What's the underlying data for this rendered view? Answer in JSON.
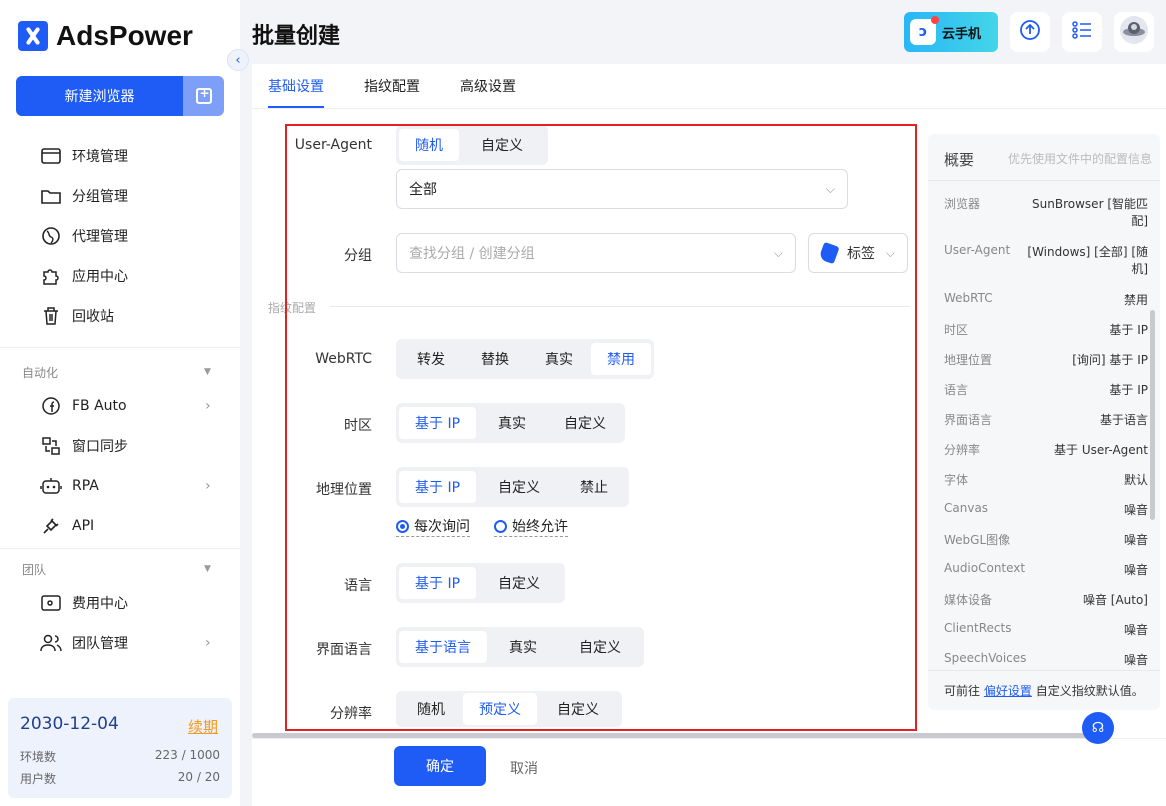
{
  "app": {
    "brand": "AdsPower"
  },
  "sidebar": {
    "new_browser": "新建浏览器",
    "items": [
      {
        "label": "环境管理",
        "icon": "browser-window-icon"
      },
      {
        "label": "分组管理",
        "icon": "folder-icon"
      },
      {
        "label": "代理管理",
        "icon": "proxy-globe-icon"
      },
      {
        "label": "应用中心",
        "icon": "puzzle-icon"
      },
      {
        "label": "回收站",
        "icon": "trash-icon"
      }
    ],
    "automation_title": "自动化",
    "automation_items": [
      {
        "label": "FB Auto",
        "icon": "facebook-icon"
      },
      {
        "label": "窗口同步",
        "icon": "window-sync-icon"
      },
      {
        "label": "RPA",
        "icon": "robot-icon"
      },
      {
        "label": "API",
        "icon": "plug-icon"
      }
    ],
    "team_title": "团队",
    "team_items": [
      {
        "label": "费用中心",
        "icon": "wallet-icon"
      },
      {
        "label": "团队管理",
        "icon": "team-icon"
      }
    ],
    "subscription": {
      "date": "2030-12-04",
      "renew": "续期",
      "env_label": "环境数",
      "env_value": "223 / 1000",
      "user_label": "用户数",
      "user_value": "20 / 20"
    }
  },
  "header": {
    "title": "批量创建",
    "cloud_phone": "云手机"
  },
  "tabs": [
    "基础设置",
    "指纹配置",
    "高级设置"
  ],
  "form": {
    "user_agent": {
      "label": "User-Agent",
      "options": [
        "随机",
        "自定义"
      ],
      "selected": "随机",
      "select_value": "全部"
    },
    "group": {
      "label": "分组",
      "placeholder": "查找分组 / 创建分组",
      "tag_label": "标签"
    },
    "section_title": "指纹配置",
    "webrtc": {
      "label": "WebRTC",
      "options": [
        "转发",
        "替换",
        "真实",
        "禁用"
      ],
      "selected": "禁用"
    },
    "timezone": {
      "label": "时区",
      "options": [
        "基于 IP",
        "真实",
        "自定义"
      ],
      "selected": "基于 IP"
    },
    "geo": {
      "label": "地理位置",
      "options": [
        "基于 IP",
        "自定义",
        "禁止"
      ],
      "selected": "基于 IP",
      "radios": [
        "每次询问",
        "始终允许"
      ],
      "radio_selected": "每次询问"
    },
    "language": {
      "label": "语言",
      "options": [
        "基于 IP",
        "自定义"
      ],
      "selected": "基于 IP"
    },
    "ui_language": {
      "label": "界面语言",
      "options": [
        "基于语言",
        "真实",
        "自定义"
      ],
      "selected": "基于语言"
    },
    "resolution": {
      "label": "分辨率",
      "options": [
        "随机",
        "预定义",
        "自定义"
      ],
      "selected": "预定义"
    }
  },
  "footer": {
    "confirm": "确定",
    "cancel": "取消"
  },
  "summary": {
    "title": "概要",
    "hint": "优先使用文件中的配置信息",
    "rows": [
      {
        "k": "浏览器",
        "v1": "SunBrowser [智能匹",
        "v2": "配]"
      },
      {
        "k": "User-Agent",
        "v1": "[Windows] [全部] [随",
        "v2": "机]"
      },
      {
        "k": "WebRTC",
        "v1": "禁用"
      },
      {
        "k": "时区",
        "v1": "基于 IP"
      },
      {
        "k": "地理位置",
        "v1": "[询问] 基于 IP"
      },
      {
        "k": "语言",
        "v1": "基于 IP"
      },
      {
        "k": "界面语言",
        "v1": "基于语言"
      },
      {
        "k": "分辨率",
        "v1": "基于 User-Agent"
      },
      {
        "k": "字体",
        "v1": "默认"
      },
      {
        "k": "Canvas",
        "v1": "噪音"
      },
      {
        "k": "WebGL图像",
        "v1": "噪音"
      },
      {
        "k": "AudioContext",
        "v1": "噪音"
      },
      {
        "k": "媒体设备",
        "v1": "噪音 [Auto]"
      },
      {
        "k": "ClientRects",
        "v1": "噪音"
      },
      {
        "k": "SpeechVoices",
        "v1": "噪音"
      }
    ],
    "foot_prefix": "可前往",
    "foot_link": "偏好设置",
    "foot_suffix": "自定义指纹默认值。"
  },
  "colors": {
    "primary": "#1f5cf5",
    "highlight": "#e52020"
  }
}
